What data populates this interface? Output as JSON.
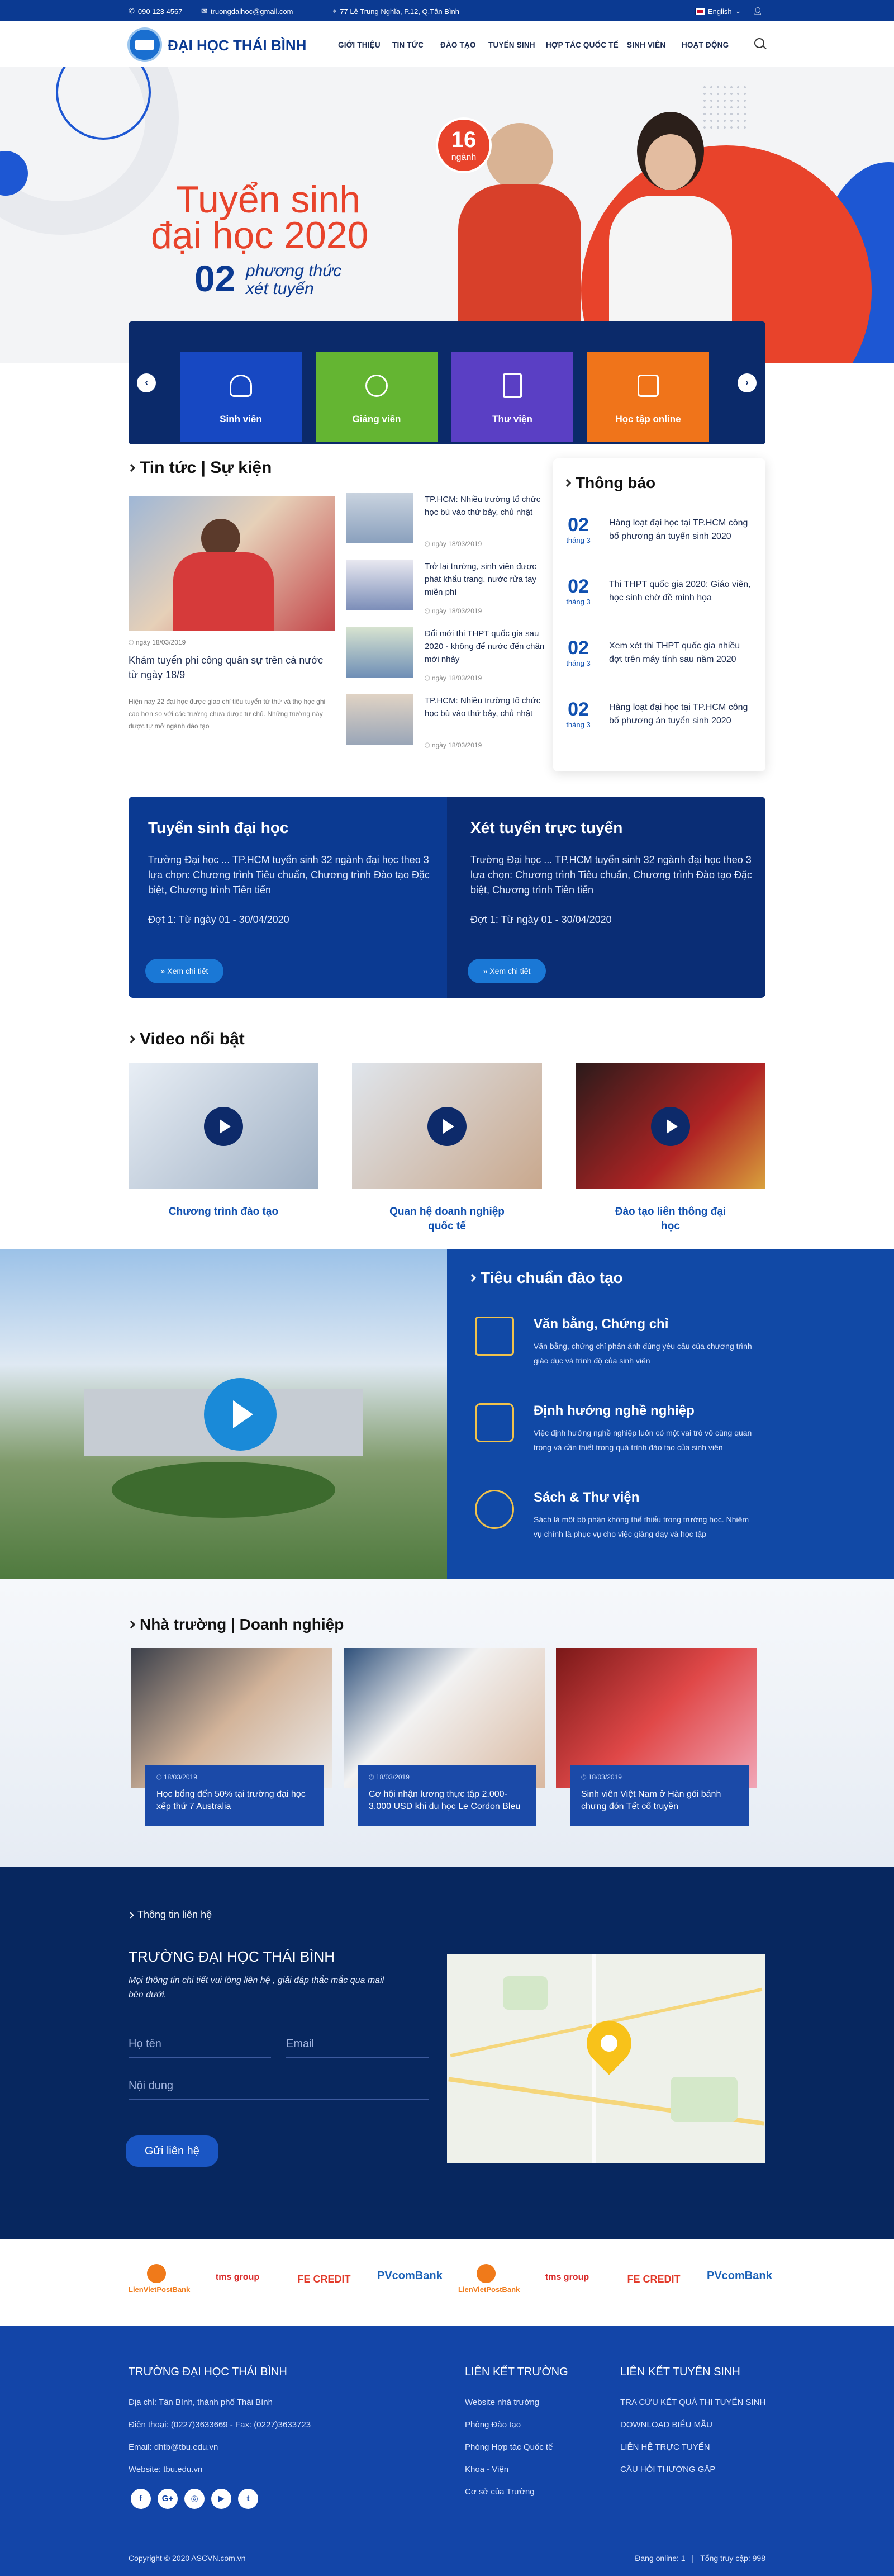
{
  "topbar": {
    "phone": "090 123 4567",
    "email": "truongdaihoc@gmail.com",
    "address": "77 Lê Trung Nghĩa, P.12, Q.Tân Bình",
    "language": "English"
  },
  "header": {
    "brand": "ĐẠI HỌC THÁI BÌNH",
    "nav": [
      "GIỚI THIỆU",
      "TIN TỨC",
      "ĐÀO TẠO",
      "TUYỂN SINH",
      "HỢP TÁC QUỐC TẾ",
      "SINH VIÊN",
      "HOẠT ĐỘNG"
    ]
  },
  "hero": {
    "line1": "Tuyển sinh",
    "line2": "đại học 2020",
    "count": "02",
    "sub1": "phương thức",
    "sub2": "xét tuyển",
    "badge_num": "16",
    "badge_txt": "ngành"
  },
  "quicklinks": [
    {
      "label": "Sinh viên",
      "color": "#1748c2",
      "icon": "student-icon"
    },
    {
      "label": "Giảng viên",
      "color": "#64b532",
      "icon": "teacher-icon"
    },
    {
      "label": "Thư viện",
      "color": "#5a3fc4",
      "icon": "book-icon"
    },
    {
      "label": "Học tập online",
      "color": "#f0741a",
      "icon": "bag-icon"
    }
  ],
  "news": {
    "title": "Tin tức | Sự kiện",
    "featured": {
      "date": "ngày 18/03/2019",
      "title": "Khám tuyển phi công quân sự trên cả nước từ ngày 18/9",
      "excerpt": "Hiện nay 22 đại học được giao chỉ tiêu tuyển từ thứ và thọ học ghi cao hơn so với các trường chưa được tự chủ. Những trường này được tự mở ngành đào tạo"
    },
    "items": [
      {
        "title": "TP.HCM: Nhiều trường tổ chức học bù vào thứ bảy, chủ nhật",
        "date": "ngày 18/03/2019"
      },
      {
        "title": "Trở lại trường, sinh viên được phát khẩu trang, nước rửa tay miễn phí",
        "date": "ngày 18/03/2019"
      },
      {
        "title": "Đổi mới thi THPT quốc gia sau 2020 - không để nước đến chân mới nhảy",
        "date": "ngày 18/03/2019"
      },
      {
        "title": "TP.HCM: Nhiều trường tổ chức học bù vào thứ bảy, chủ nhật",
        "date": "ngày 18/03/2019"
      }
    ]
  },
  "notices": {
    "title": "Thông báo",
    "items": [
      {
        "day": "02",
        "month": "tháng 3",
        "title": "Hàng loạt đại học tại TP.HCM công bố phương án tuyển sinh 2020"
      },
      {
        "day": "02",
        "month": "tháng 3",
        "title": "Thi THPT quốc gia 2020: Giáo viên, học sinh chờ đề minh họa"
      },
      {
        "day": "02",
        "month": "tháng 3",
        "title": "Xem xét thi THPT quốc gia nhiều đợt trên máy tính sau năm 2020"
      },
      {
        "day": "02",
        "month": "tháng 3",
        "title": "Hàng loạt đại học tại TP.HCM công bố phương án tuyển sinh 2020"
      }
    ]
  },
  "admission": [
    {
      "title": "Tuyển sinh đại học",
      "text": "Trường Đại học ... TP.HCM  tuyển sinh 32 ngành đại học theo 3 lựa chọn: Chương trình Tiêu chuẩn, Chương trình Đào tạo Đặc biệt, Chương trình Tiên tiến",
      "round": "Đợt 1: Từ ngày 01 - 30/04/2020",
      "button": "» Xem chi tiết"
    },
    {
      "title": "Xét tuyển trực tuyến",
      "text": "Trường Đại học ... TP.HCM  tuyển sinh 32 ngành đại học theo 3 lựa chọn: Chương trình Tiêu chuẩn, Chương trình Đào tạo Đặc biệt, Chương trình Tiên tiến",
      "round": "Đợt 1: Từ ngày 01 - 30/04/2020",
      "button": "» Xem chi tiết"
    }
  ],
  "videos": {
    "title": "Video nổi bật",
    "items": [
      {
        "caption": "Chương trình đào tạo"
      },
      {
        "caption": "Quan hệ doanh nghiệp quốc tế"
      },
      {
        "caption": "Đào tạo liên thông đại học"
      }
    ]
  },
  "standards": {
    "title": "Tiêu chuẩn đào tạo",
    "items": [
      {
        "title": "Văn bằng, Chứng chỉ",
        "text": "Văn bằng, chứng chỉ phản ánh đúng yêu cầu của chương trình giáo dục và trình độ của sinh viên",
        "icon": "certificate-icon"
      },
      {
        "title": "Định hướng nghề nghiệp",
        "text": "Việc định hướng nghề nghiệp luôn có một vai trò vô cùng quan trọng và cần thiết trong quá trình đào tạo của sinh viên",
        "icon": "career-icon"
      },
      {
        "title": "Sách & Thư viện",
        "text": "Sách là một bộ phận không thể thiếu trong trường học. Nhiệm vụ chính là phục vụ cho việc giảng dạy và học tập",
        "icon": "library-icon"
      }
    ]
  },
  "partners": {
    "title": "Nhà trường | Doanh nghiệp",
    "items": [
      {
        "date": "18/03/2019",
        "title": "Học bổng đến 50% tại trường đại học xếp thứ 7 Australia"
      },
      {
        "date": "18/03/2019",
        "title": "Cơ hội nhận lương thực tập 2.000-3.000 USD khi du học Le Cordon Bleu"
      },
      {
        "date": "18/03/2019",
        "title": "Sinh viên Việt Nam ở Hàn gói bánh chưng đón Tết cổ truyền"
      }
    ]
  },
  "contact": {
    "label": "Thông tin liên hệ",
    "heading": "TRƯỜNG ĐẠI HỌC THÁI BÌNH",
    "text": "Mọi thông tin chi tiết vui lòng liên hệ , giải đáp thắc mắc qua mail bên dưới.",
    "name_ph": "Họ tên",
    "email_ph": "Email",
    "content_ph": "Nội dung",
    "button": "Gửi liên hệ"
  },
  "logos": [
    "LienVietPostBank",
    "tms group",
    "FE CREDIT",
    "PVcomBank",
    "LienVietPostBank",
    "tms group",
    "FE CREDIT",
    "PVcomBank"
  ],
  "footer": {
    "school": "TRƯỜNG ĐẠI HỌC THÁI BÌNH",
    "address": "Địa chỉ: Tân Bình, thành phố Thái Bình",
    "phone": "Điện thoại: (0227)3633669 - Fax: (0227)3633723",
    "email": "Email: dhtb@tbu.edu.vn",
    "website": "Website: tbu.edu.vn",
    "col2_title": "LIÊN KẾT TRƯỜNG",
    "col2": [
      "Website nhà trường",
      "Phòng Đào tạo",
      "Phòng Hợp tác Quốc tế",
      "Khoa - Viện",
      "Cơ sở của Trường"
    ],
    "col3_title": "LIÊN KẾT TUYỂN SINH",
    "col3": [
      "TRA CỨU KẾT QUẢ THI TUYỂN SINH",
      "DOWNLOAD BIỂU MẪU",
      "LIÊN HỆ TRỰC TUYẾN",
      "CÂU HỎI THƯỜNG GẶP"
    ],
    "copyright": "Copyright © 2020 ASCVN.com.vn",
    "online": "Đang online: 1   |   Tổng truy cập: 998"
  }
}
